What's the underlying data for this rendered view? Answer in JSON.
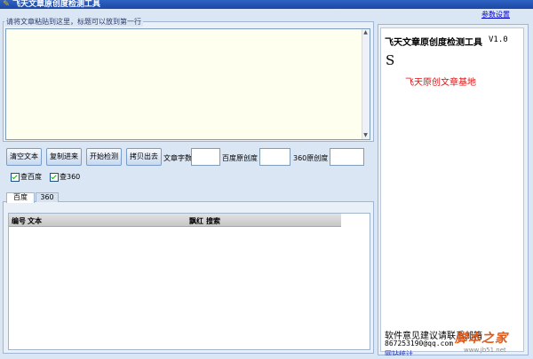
{
  "window": {
    "title": "飞天文章原创度检测工具",
    "app_icon": "feather-icon"
  },
  "menu": {
    "settings_label": "参数设置"
  },
  "input": {
    "legend": "请将文章粘贴到这里，标题可以放到第一行",
    "value": ""
  },
  "toolbar": {
    "clear_label": "清空文本",
    "copy_label": "复制进来",
    "start_label": "开始检测",
    "paste_label": "拷贝出去",
    "word_count_label": "文章字数",
    "word_count_value": "",
    "baidu_orig_label": "百度原创度",
    "baidu_orig_value": "",
    "orig360_label": "360原创度",
    "orig360_value": ""
  },
  "checks": [
    {
      "label": "查百度",
      "checked": true
    },
    {
      "label": "查360",
      "checked": true
    }
  ],
  "tabs": [
    "百度",
    "360"
  ],
  "table": {
    "columns": [
      "编号",
      "文本",
      "飘红",
      "搜索"
    ],
    "rows": []
  },
  "right_panel": {
    "title": "飞天文章原创度检测工具",
    "version": "V1.0",
    "letter": "S",
    "slogan": "飞天原创文章基地",
    "feedback_label": "软件意见建议请联系邮箱",
    "feedback_email": "867253190@qq.com",
    "stats_link": "网站统计"
  },
  "watermark": {
    "logo": "脚本之家",
    "url": "www.jb51.net"
  },
  "colors": {
    "title_bar": "#1c47a5",
    "slogan": "#e01010",
    "link": "#0000cc",
    "watermark": "#e05a1a"
  }
}
